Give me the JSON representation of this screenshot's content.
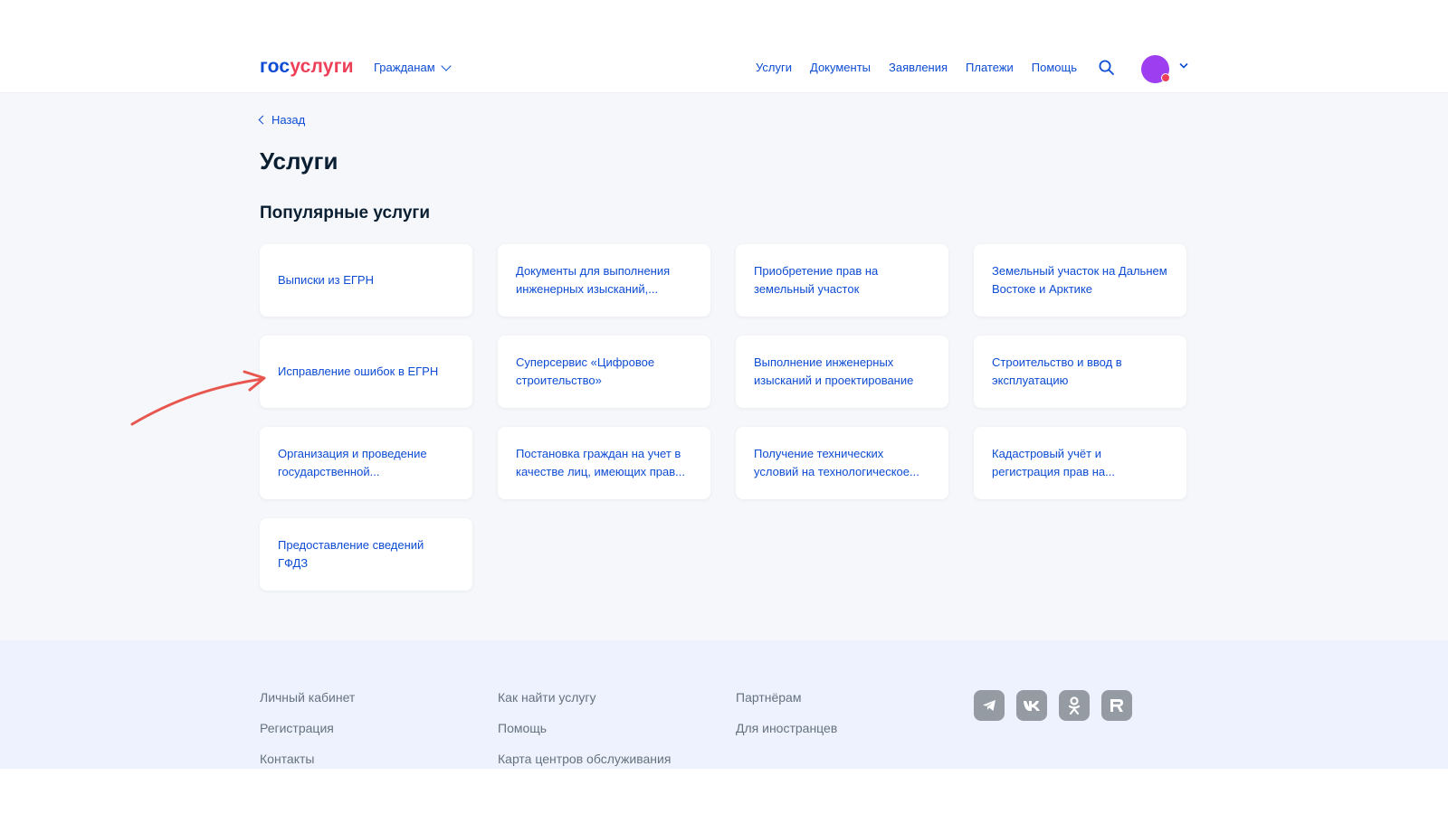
{
  "header": {
    "logo_part1": "гос",
    "logo_part2": "услуги",
    "role_selector": "Гражданам",
    "nav": [
      "Услуги",
      "Документы",
      "Заявления",
      "Платежи",
      "Помощь"
    ]
  },
  "main": {
    "back_link": "Назад",
    "title": "Услуги",
    "section_title": "Популярные услуги",
    "services": [
      "Выписки из ЕГРН",
      "Документы для выполнения инженерных изысканий,...",
      "Приобретение прав на земельный участок",
      "Земельный участок на Дальнем Востоке и Арктике",
      "Исправление ошибок в ЕГРН",
      "Суперсервис «Цифровое строительство»",
      "Выполнение инженерных изысканий и проектирование",
      "Строительство и ввод в эксплуатацию",
      "Организация и проведение государственной...",
      "Постановка граждан на учет в качестве лиц, имеющих прав...",
      "Получение технических условий на технологическое...",
      "Кадастровый учёт и регистрация прав на...",
      "Предоставление сведений ГФДЗ"
    ]
  },
  "footer": {
    "col1": [
      "Личный кабинет",
      "Регистрация",
      "Контакты"
    ],
    "col2": [
      "Как найти услугу",
      "Помощь",
      "Карта центров обслуживания"
    ],
    "col3": [
      "Партнёрам",
      "Для иностранцев"
    ],
    "social_icons": [
      "telegram-icon",
      "vk-icon",
      "odnoklassniki-icon",
      "rutube-icon"
    ]
  },
  "colors": {
    "link_blue": "#0d4cd3",
    "logo_red": "#ee3f58",
    "avatar_purple": "#9d3ef0",
    "page_bg": "#f5f7fa",
    "footer_bg": "#edf2fe",
    "annotation_arrow": "#e8574f"
  }
}
